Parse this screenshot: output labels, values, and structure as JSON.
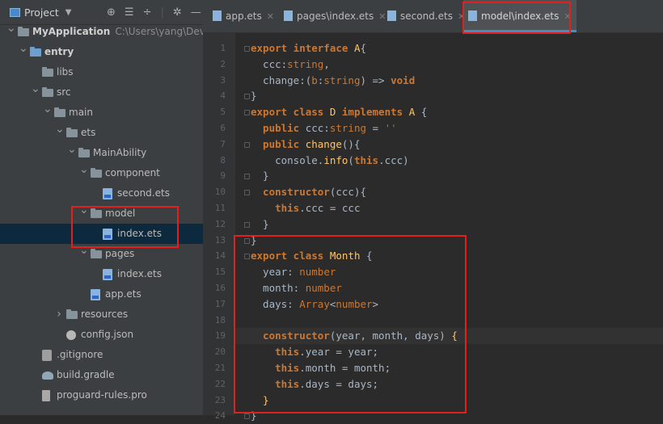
{
  "project_panel": {
    "title": "Project",
    "tool_icons": [
      "target-icon",
      "collapse-all-icon",
      "expand-icon",
      "gear-icon",
      "minimize-icon"
    ],
    "tree": [
      {
        "indent": 0,
        "arrow": "v",
        "icon": "folder",
        "label": "MyApplication",
        "path": "C:\\Users\\yang\\DevEcoSt",
        "bold": true
      },
      {
        "indent": 1,
        "arrow": "v",
        "icon": "folder-blue",
        "label": "entry",
        "bold": true
      },
      {
        "indent": 2,
        "arrow": "",
        "icon": "folder",
        "label": "libs"
      },
      {
        "indent": 2,
        "arrow": "v",
        "icon": "folder",
        "label": "src"
      },
      {
        "indent": 3,
        "arrow": "v",
        "icon": "folder",
        "label": "main"
      },
      {
        "indent": 4,
        "arrow": "v",
        "icon": "folder",
        "label": "ets"
      },
      {
        "indent": 5,
        "arrow": "v",
        "icon": "folder",
        "label": "MainAbility"
      },
      {
        "indent": 6,
        "arrow": "v",
        "icon": "folder",
        "label": "component"
      },
      {
        "indent": 7,
        "arrow": "",
        "icon": "ets",
        "label": "second.ets"
      },
      {
        "indent": 6,
        "arrow": "v",
        "icon": "folder",
        "label": "model"
      },
      {
        "indent": 7,
        "arrow": "",
        "icon": "ets",
        "label": "index.ets",
        "selected": true
      },
      {
        "indent": 6,
        "arrow": "v",
        "icon": "folder",
        "label": "pages"
      },
      {
        "indent": 7,
        "arrow": "",
        "icon": "ets",
        "label": "index.ets"
      },
      {
        "indent": 6,
        "arrow": "",
        "icon": "ets",
        "label": "app.ets"
      },
      {
        "indent": 4,
        "arrow": ">",
        "icon": "folder",
        "label": "resources"
      },
      {
        "indent": 4,
        "arrow": "",
        "icon": "json",
        "label": "config.json"
      },
      {
        "indent": 2,
        "arrow": "",
        "icon": "git",
        "label": ".gitignore"
      },
      {
        "indent": 2,
        "arrow": "",
        "icon": "gradle",
        "label": "build.gradle"
      },
      {
        "indent": 2,
        "arrow": "",
        "icon": "pro",
        "label": "proguard-rules.pro"
      }
    ]
  },
  "tabs": [
    {
      "label": "app.ets"
    },
    {
      "label": "pages\\index.ets"
    },
    {
      "label": "second.ets"
    },
    {
      "label": "model\\index.ets",
      "active": true
    }
  ],
  "colors": {
    "highlight_box": "#e0211d",
    "accent": "#4a88c7"
  },
  "editor": {
    "current_line": 19,
    "lines": [
      {
        "n": "1",
        "tokens": [
          [
            "kw",
            "export interface "
          ],
          [
            "cls",
            "A"
          ],
          [
            "p",
            "{"
          ]
        ]
      },
      {
        "n": "2",
        "tokens": [
          [
            "p",
            "  ccc:"
          ],
          [
            "ty",
            "string"
          ],
          [
            "p",
            ","
          ]
        ]
      },
      {
        "n": "3",
        "tokens": [
          [
            "p",
            "  change:("
          ],
          [
            "ty",
            "b"
          ],
          [
            "p",
            ":"
          ],
          [
            "ty",
            "string"
          ],
          [
            "p",
            ") => "
          ],
          [
            "kw",
            "void"
          ]
        ]
      },
      {
        "n": "4",
        "tokens": [
          [
            "p",
            "}"
          ]
        ]
      },
      {
        "n": "5",
        "tokens": [
          [
            "kw",
            "export class "
          ],
          [
            "cls",
            "D "
          ],
          [
            "kw",
            "implements "
          ],
          [
            "cls",
            "A "
          ],
          [
            "p",
            "{"
          ]
        ]
      },
      {
        "n": "6",
        "tokens": [
          [
            "kw",
            "  public "
          ],
          [
            "p",
            "ccc:"
          ],
          [
            "ty",
            "string"
          ],
          [
            "p",
            " = "
          ],
          [
            "str",
            "''"
          ]
        ]
      },
      {
        "n": "7",
        "tokens": [
          [
            "kw",
            "  public "
          ],
          [
            "fn",
            "change"
          ],
          [
            "p",
            "(){"
          ]
        ]
      },
      {
        "n": "8",
        "tokens": [
          [
            "p",
            "    console."
          ],
          [
            "fn",
            "info"
          ],
          [
            "p",
            "("
          ],
          [
            "kw",
            "this"
          ],
          [
            "p",
            ".ccc)"
          ]
        ]
      },
      {
        "n": "9",
        "tokens": [
          [
            "p",
            "  }"
          ]
        ]
      },
      {
        "n": "10",
        "tokens": [
          [
            "kw",
            "  constructor"
          ],
          [
            "p",
            "(ccc){"
          ]
        ]
      },
      {
        "n": "11",
        "tokens": [
          [
            "kw",
            "    this"
          ],
          [
            "p",
            ".ccc = ccc"
          ]
        ]
      },
      {
        "n": "12",
        "tokens": [
          [
            "p",
            "  }"
          ]
        ]
      },
      {
        "n": "13",
        "tokens": [
          [
            "p",
            "}"
          ]
        ]
      },
      {
        "n": "14",
        "tokens": [
          [
            "kw",
            "export class "
          ],
          [
            "cls",
            "Month "
          ],
          [
            "p",
            "{"
          ]
        ]
      },
      {
        "n": "15",
        "tokens": [
          [
            "p",
            "  year: "
          ],
          [
            "ty",
            "number"
          ]
        ]
      },
      {
        "n": "16",
        "tokens": [
          [
            "p",
            "  month: "
          ],
          [
            "ty",
            "number"
          ]
        ]
      },
      {
        "n": "17",
        "tokens": [
          [
            "p",
            "  days: "
          ],
          [
            "ty",
            "Array"
          ],
          [
            "p",
            "<"
          ],
          [
            "ty",
            "number"
          ],
          [
            "p",
            ">"
          ]
        ]
      },
      {
        "n": "18",
        "tokens": [
          [
            "p",
            ""
          ]
        ]
      },
      {
        "n": "19",
        "tokens": [
          [
            "kw",
            "  constructor"
          ],
          [
            "p",
            "(year, month, days) "
          ],
          [
            "cls",
            "{"
          ]
        ]
      },
      {
        "n": "20",
        "tokens": [
          [
            "kw",
            "    this"
          ],
          [
            "p",
            ".year = year;"
          ]
        ]
      },
      {
        "n": "21",
        "tokens": [
          [
            "kw",
            "    this"
          ],
          [
            "p",
            ".month = month;"
          ]
        ]
      },
      {
        "n": "22",
        "tokens": [
          [
            "kw",
            "    this"
          ],
          [
            "p",
            ".days = days;"
          ]
        ]
      },
      {
        "n": "23",
        "tokens": [
          [
            "cls",
            "  }"
          ]
        ]
      },
      {
        "n": "24",
        "tokens": [
          [
            "p",
            "}"
          ]
        ]
      }
    ]
  }
}
